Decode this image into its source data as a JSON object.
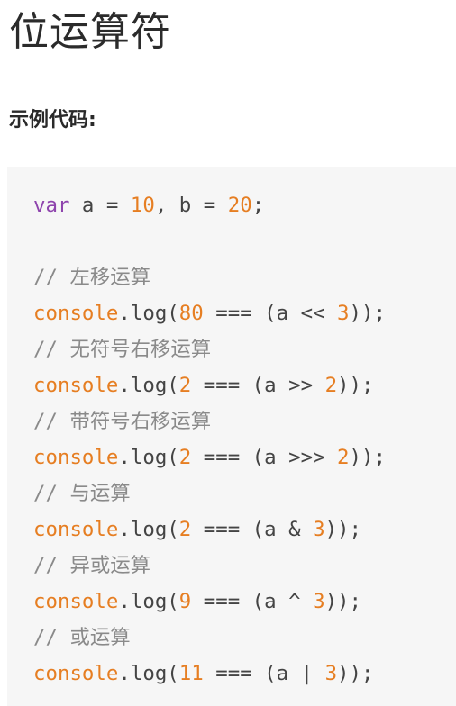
{
  "title": "位运算符",
  "section_label": "示例代码:",
  "colors": {
    "keyword": "#8e44ad",
    "number": "#e67e22",
    "comment": "#8a8a8a",
    "text": "#444444",
    "code_background": "#f6f6f6"
  },
  "code": {
    "lines": [
      [
        {
          "t": "kw",
          "v": "var"
        },
        {
          "t": "plain",
          "v": " a = "
        },
        {
          "t": "num",
          "v": "10"
        },
        {
          "t": "plain",
          "v": ", b = "
        },
        {
          "t": "num",
          "v": "20"
        },
        {
          "t": "plain",
          "v": ";"
        }
      ],
      [],
      [
        {
          "t": "comment",
          "v": "// 左移运算"
        }
      ],
      [
        {
          "t": "obj",
          "v": "console"
        },
        {
          "t": "plain",
          "v": ".log("
        },
        {
          "t": "num",
          "v": "80"
        },
        {
          "t": "plain",
          "v": " === (a << "
        },
        {
          "t": "num",
          "v": "3"
        },
        {
          "t": "plain",
          "v": "));"
        }
      ],
      [
        {
          "t": "comment",
          "v": "// 无符号右移运算"
        }
      ],
      [
        {
          "t": "obj",
          "v": "console"
        },
        {
          "t": "plain",
          "v": ".log("
        },
        {
          "t": "num",
          "v": "2"
        },
        {
          "t": "plain",
          "v": " === (a >> "
        },
        {
          "t": "num",
          "v": "2"
        },
        {
          "t": "plain",
          "v": "));"
        }
      ],
      [
        {
          "t": "comment",
          "v": "// 带符号右移运算"
        }
      ],
      [
        {
          "t": "obj",
          "v": "console"
        },
        {
          "t": "plain",
          "v": ".log("
        },
        {
          "t": "num",
          "v": "2"
        },
        {
          "t": "plain",
          "v": " === (a >>> "
        },
        {
          "t": "num",
          "v": "2"
        },
        {
          "t": "plain",
          "v": "));"
        }
      ],
      [
        {
          "t": "comment",
          "v": "// 与运算"
        }
      ],
      [
        {
          "t": "obj",
          "v": "console"
        },
        {
          "t": "plain",
          "v": ".log("
        },
        {
          "t": "num",
          "v": "2"
        },
        {
          "t": "plain",
          "v": " === (a & "
        },
        {
          "t": "num",
          "v": "3"
        },
        {
          "t": "plain",
          "v": "));"
        }
      ],
      [
        {
          "t": "comment",
          "v": "// 异或运算"
        }
      ],
      [
        {
          "t": "obj",
          "v": "console"
        },
        {
          "t": "plain",
          "v": ".log("
        },
        {
          "t": "num",
          "v": "9"
        },
        {
          "t": "plain",
          "v": " === (a ^ "
        },
        {
          "t": "num",
          "v": "3"
        },
        {
          "t": "plain",
          "v": "));"
        }
      ],
      [
        {
          "t": "comment",
          "v": "// 或运算"
        }
      ],
      [
        {
          "t": "obj",
          "v": "console"
        },
        {
          "t": "plain",
          "v": ".log("
        },
        {
          "t": "num",
          "v": "11"
        },
        {
          "t": "plain",
          "v": " === (a | "
        },
        {
          "t": "num",
          "v": "3"
        },
        {
          "t": "plain",
          "v": "));"
        }
      ]
    ]
  }
}
